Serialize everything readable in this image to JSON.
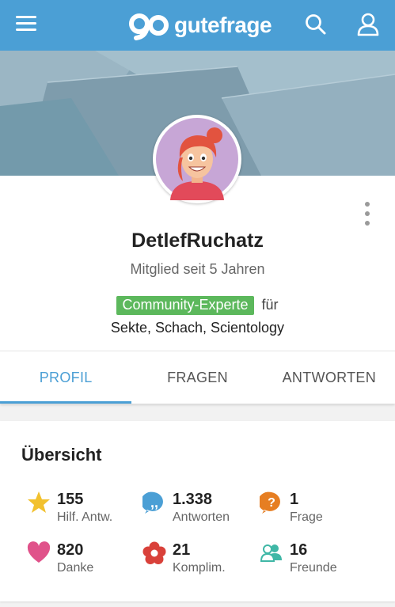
{
  "header": {
    "logo_text": "gutefrage",
    "menu_icon": "hamburger-menu-icon",
    "search_icon": "search-icon",
    "user_icon": "user-icon",
    "brand_color": "#4b9fd5"
  },
  "profile": {
    "username": "DetlefRuchatz",
    "member_since": "Mitglied seit 5 Jahren",
    "badge": "Community-Experte",
    "badge_suffix": "für",
    "topics": "Sekte, Schach, Scientology",
    "badge_color": "#5cb85c"
  },
  "tabs": [
    {
      "label": "PROFIL",
      "active": true
    },
    {
      "label": "FRAGEN",
      "active": false
    },
    {
      "label": "ANTWORTEN",
      "active": false
    }
  ],
  "overview": {
    "title": "Übersicht",
    "stats": [
      {
        "value": "155",
        "label": "Hilf. Antw.",
        "icon": "star-icon",
        "color": "#f2c12e"
      },
      {
        "value": "1.338",
        "label": "Antworten",
        "icon": "quote-bubble-icon",
        "color": "#4b9fd5"
      },
      {
        "value": "1",
        "label": "Frage",
        "icon": "question-bubble-icon",
        "color": "#e67e22"
      },
      {
        "value": "820",
        "label": "Danke",
        "icon": "heart-icon",
        "color": "#e0528a"
      },
      {
        "value": "21",
        "label": "Komplim.",
        "icon": "flower-icon",
        "color": "#d9413a"
      },
      {
        "value": "16",
        "label": "Freunde",
        "icon": "friends-icon",
        "color": "#3fb7a6"
      }
    ]
  }
}
